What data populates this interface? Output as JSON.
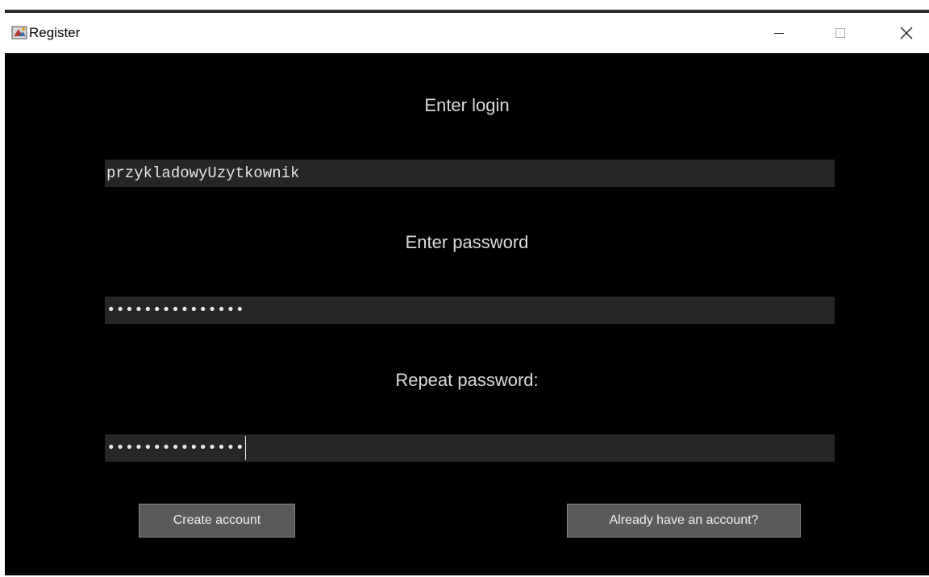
{
  "window": {
    "title": "Register",
    "controls": [
      "minimize-icon",
      "maximize-icon",
      "close-icon"
    ]
  },
  "form": {
    "login_label": "Enter login",
    "login_value": "przykladowyUzytkownik",
    "password_label": "Enter password",
    "password_value": "•••••••••••••••",
    "repeat_label": "Repeat password:",
    "repeat_value": "•••••••••••••••"
  },
  "buttons": {
    "create": "Create account",
    "already": "Already have an account?"
  },
  "colors": {
    "background": "#000000",
    "field": "#262626",
    "button": "#5a5a5a"
  }
}
